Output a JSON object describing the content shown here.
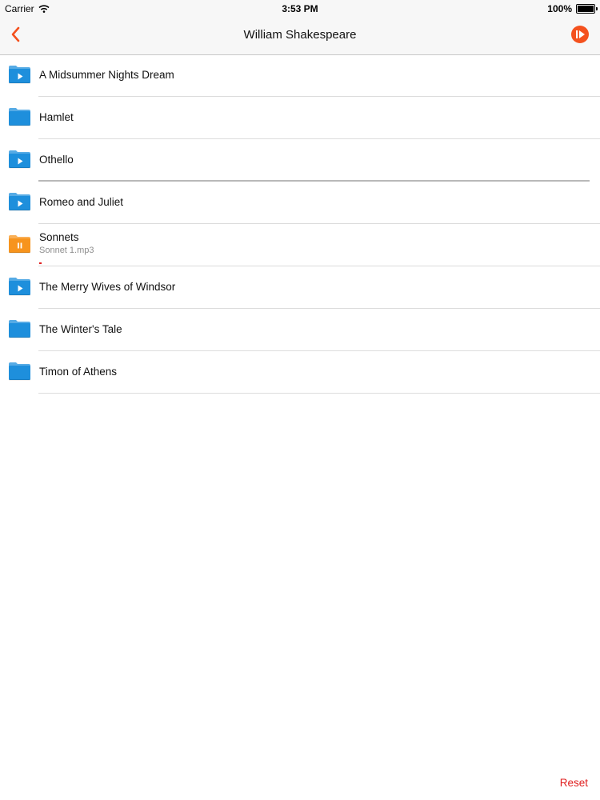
{
  "status_bar": {
    "carrier": "Carrier",
    "time": "3:53 PM",
    "battery_percent": "100%",
    "battery_level": 1.0
  },
  "nav": {
    "title": "William Shakespeare",
    "back_icon": "chevron-left-icon",
    "now_playing_icon": "now-playing-icon",
    "accent_color": "#f4511e"
  },
  "items": [
    {
      "title": "A Midsummer Nights Dream",
      "icon": "folder-play-icon",
      "color": "#1e8fdc"
    },
    {
      "title": "Hamlet",
      "icon": "folder-icon",
      "color": "#1e8fdc"
    },
    {
      "title": "Othello",
      "icon": "folder-play-icon",
      "color": "#1e8fdc"
    },
    {
      "title": "Romeo and Juliet",
      "icon": "folder-play-icon",
      "color": "#1e8fdc"
    },
    {
      "title": "Sonnets",
      "subtitle": "Sonnet 1.mp3",
      "icon": "folder-pause-icon",
      "color": "#f7941d"
    },
    {
      "title": "The Merry Wives of Windsor",
      "icon": "folder-play-icon",
      "color": "#1e8fdc"
    },
    {
      "title": "The Winter's Tale",
      "icon": "folder-icon",
      "color": "#1e8fdc"
    },
    {
      "title": "Timon of Athens",
      "icon": "folder-icon",
      "color": "#1e8fdc"
    }
  ],
  "footer": {
    "reset_label": "Reset",
    "reset_color": "#e02020"
  }
}
